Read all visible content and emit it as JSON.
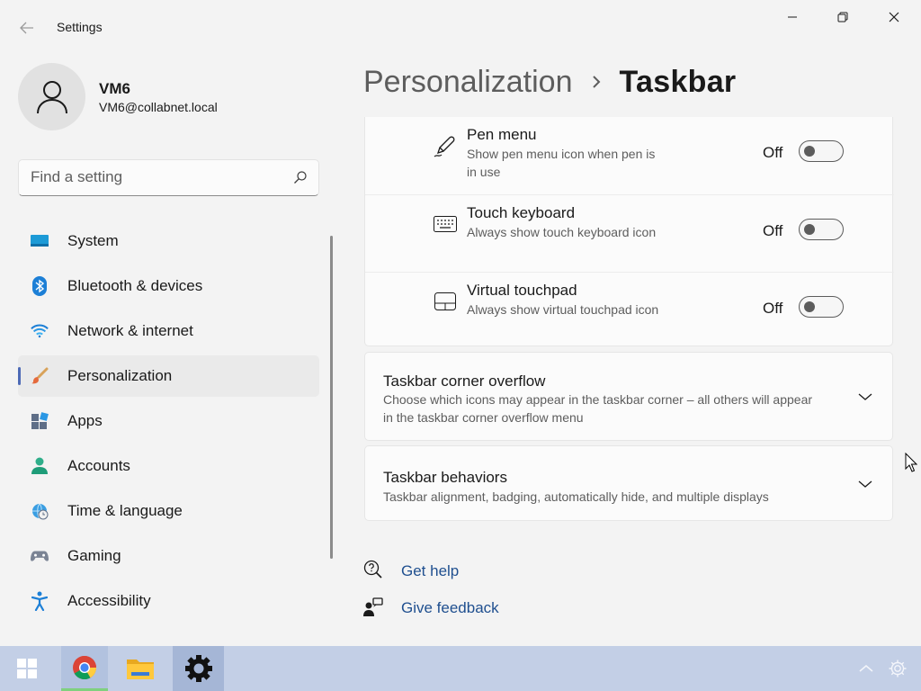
{
  "window": {
    "app_title": "Settings"
  },
  "user": {
    "name": "VM6",
    "email": "VM6@collabnet.local"
  },
  "search": {
    "placeholder": "Find a setting"
  },
  "sidebar": {
    "items": [
      {
        "label": "System",
        "icon": "monitor-icon"
      },
      {
        "label": "Bluetooth & devices",
        "icon": "bluetooth-icon"
      },
      {
        "label": "Network & internet",
        "icon": "wifi-icon"
      },
      {
        "label": "Personalization",
        "icon": "paintbrush-icon",
        "selected": true
      },
      {
        "label": "Apps",
        "icon": "apps-icon"
      },
      {
        "label": "Accounts",
        "icon": "person-icon"
      },
      {
        "label": "Time & language",
        "icon": "globe-clock-icon"
      },
      {
        "label": "Gaming",
        "icon": "gamepad-icon"
      },
      {
        "label": "Accessibility",
        "icon": "accessibility-icon"
      }
    ]
  },
  "header": {
    "parent": "Personalization",
    "separator": ">",
    "current": "Taskbar"
  },
  "settings": {
    "rows": [
      {
        "title": "Pen menu",
        "desc": "Show pen menu icon when pen is in use",
        "state": "Off",
        "icon": "pen-icon"
      },
      {
        "title": "Touch keyboard",
        "desc": "Always show touch keyboard icon",
        "state": "Off",
        "icon": "keyboard-icon"
      },
      {
        "title": "Virtual touchpad",
        "desc": "Always show virtual touchpad icon",
        "state": "Off",
        "icon": "touchpad-icon"
      }
    ],
    "corner_overflow": {
      "title": "Taskbar corner overflow",
      "desc": "Choose which icons may appear in the taskbar corner – all others will appear in the taskbar corner overflow menu"
    },
    "behaviors": {
      "title": "Taskbar behaviors",
      "desc": "Taskbar alignment, badging, automatically hide, and multiple displays"
    }
  },
  "links": {
    "help": "Get help",
    "feedback": "Give feedback"
  },
  "colors": {
    "accent": "#4d6ab6",
    "link": "#1f4f8f",
    "taskbar": "#c3cfe6"
  }
}
